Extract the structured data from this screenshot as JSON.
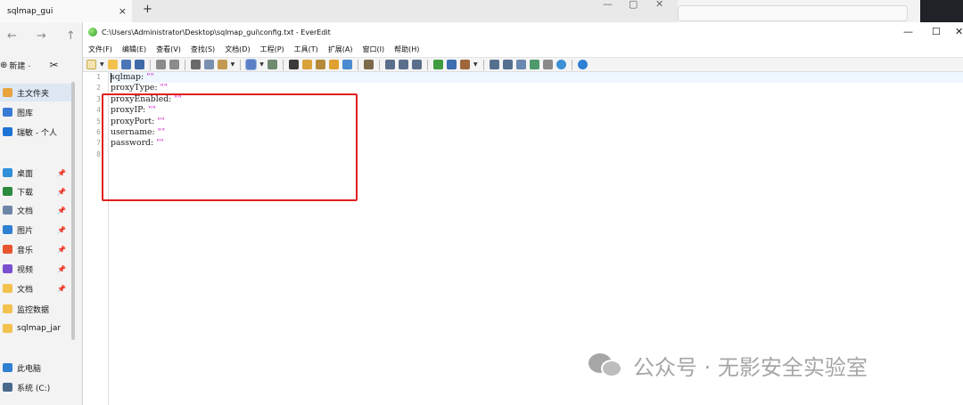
{
  "explorer": {
    "tab_title": "sqlmap_gui",
    "tab_close": "×",
    "new_tab": "+",
    "caption": {
      "min": "—",
      "max": "▢",
      "close": "✕"
    },
    "nav": {
      "back": "←",
      "forward": "→",
      "up": "↑"
    },
    "new_button": "新建",
    "sidebar": [
      {
        "label": "主文件夹",
        "icon": "home-icon",
        "color": "#e8a33c",
        "pinned": false
      },
      {
        "label": "图库",
        "icon": "gallery-icon",
        "color": "#3a7bd5",
        "pinned": false
      },
      {
        "label": "瑞敏 - 个人",
        "icon": "cloud-icon",
        "color": "#1e73d6",
        "pinned": false
      },
      {
        "label": "桌面",
        "icon": "desktop-icon",
        "color": "#2f8fd8",
        "pinned": true
      },
      {
        "label": "下载",
        "icon": "download-icon",
        "color": "#2b8a3e",
        "pinned": true
      },
      {
        "label": "文档",
        "icon": "documents-icon",
        "color": "#6d86a8",
        "pinned": true
      },
      {
        "label": "图片",
        "icon": "pictures-icon",
        "color": "#2f7fd3",
        "pinned": true
      },
      {
        "label": "音乐",
        "icon": "music-icon",
        "color": "#e8562f",
        "pinned": true
      },
      {
        "label": "视频",
        "icon": "video-icon",
        "color": "#7a4fcf",
        "pinned": true
      },
      {
        "label": "文档",
        "icon": "folder-icon",
        "color": "#f2c14e",
        "pinned": true
      },
      {
        "label": "监控数据",
        "icon": "folder-icon",
        "color": "#f2c14e",
        "pinned": false
      },
      {
        "label": "sqlmap_jar",
        "icon": "folder-icon",
        "color": "#f2c14e",
        "pinned": false
      },
      {
        "label": "此电脑",
        "icon": "computer-icon",
        "color": "#2f7fd3",
        "pinned": false
      },
      {
        "label": "系统 (C:)",
        "icon": "drive-icon",
        "color": "#4a6a8c",
        "pinned": false
      }
    ]
  },
  "editor": {
    "title": "C:\\Users\\Administrator\\Desktop\\sqlmap_gui\\config.txt - EverEdit",
    "window_controls": {
      "min": "—",
      "max": "☐",
      "close": "✕"
    },
    "menu": [
      "文件(F)",
      "编辑(E)",
      "查看(V)",
      "查找(S)",
      "文档(D)",
      "工程(P)",
      "工具(T)",
      "扩展(A)",
      "窗口(I)",
      "帮助(H)"
    ],
    "line_numbers": [
      "1",
      "2",
      "3",
      "4",
      "5",
      "6",
      "7",
      "8"
    ],
    "lines": [
      {
        "key": "sqlmap:",
        "value": "\"\""
      },
      {
        "key": "proxyType:",
        "value": "\"\""
      },
      {
        "key": "proxyEnabled:",
        "value": "\"\""
      },
      {
        "key": "proxyIP:",
        "value": "\"\""
      },
      {
        "key": "proxyPort:",
        "value": "\"\""
      },
      {
        "key": "username:",
        "value": "\"\""
      },
      {
        "key": "password:",
        "value": "\"\""
      },
      {
        "key": "",
        "value": ""
      }
    ],
    "highlight_color": "#e02020"
  },
  "watermark": {
    "text": "公众号 · 无影安全实验室"
  }
}
